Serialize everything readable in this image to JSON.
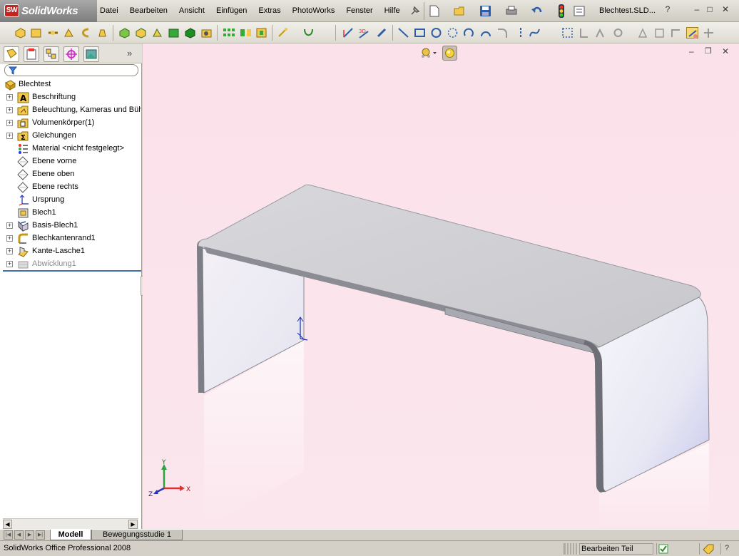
{
  "app": {
    "logo_text": "SolidWorks",
    "logo_badge": "SW"
  },
  "menu": [
    "Datei",
    "Bearbeiten",
    "Ansicht",
    "Einfügen",
    "Extras",
    "PhotoWorks",
    "Fenster",
    "Hilfe"
  ],
  "window": {
    "document_title": "Blechtest.SLD...",
    "help_glyph": "?",
    "minimize_glyph": "–",
    "restore_glyph": "□",
    "close_glyph": "✕"
  },
  "feature_tree": {
    "root": "Blechtest",
    "items": [
      {
        "label": "Beschriftung",
        "expandable": true,
        "icon": "annotation-icon"
      },
      {
        "label": "Beleuchtung, Kameras und Bühne",
        "expandable": true,
        "icon": "lights-cameras-icon"
      },
      {
        "label": "Volumenkörper(1)",
        "expandable": true,
        "icon": "solid-bodies-icon"
      },
      {
        "label": "Gleichungen",
        "expandable": true,
        "icon": "equations-icon"
      },
      {
        "label": "Material <nicht festgelegt>",
        "expandable": false,
        "icon": "material-icon"
      },
      {
        "label": "Ebene vorne",
        "expandable": false,
        "icon": "plane-icon"
      },
      {
        "label": "Ebene oben",
        "expandable": false,
        "icon": "plane-icon"
      },
      {
        "label": "Ebene rechts",
        "expandable": false,
        "icon": "plane-icon"
      },
      {
        "label": "Ursprung",
        "expandable": false,
        "icon": "origin-icon"
      },
      {
        "label": "Blech1",
        "expandable": false,
        "icon": "sheet-metal-icon"
      },
      {
        "label": "Basis-Blech1",
        "expandable": true,
        "icon": "base-flange-icon"
      },
      {
        "label": "Blechkantenrand1",
        "expandable": true,
        "icon": "edge-flange-icon"
      },
      {
        "label": "Kante-Lasche1",
        "expandable": true,
        "icon": "tab-edge-icon"
      },
      {
        "label": "Abwicklung1",
        "expandable": true,
        "icon": "flat-pattern-icon",
        "suppressed": true
      }
    ]
  },
  "triad": {
    "x": "X",
    "y": "Y",
    "z": "Z"
  },
  "bottom_tabs": [
    "Modell",
    "Bewegungsstudie 1"
  ],
  "status": {
    "text": "SolidWorks Office Professional 2008",
    "mode": "Bearbeiten Teil"
  },
  "colors": {
    "viewport_bg": "#fbe3eb",
    "accent_blue": "#3f6fb6",
    "logo_red": "#c8231e"
  }
}
